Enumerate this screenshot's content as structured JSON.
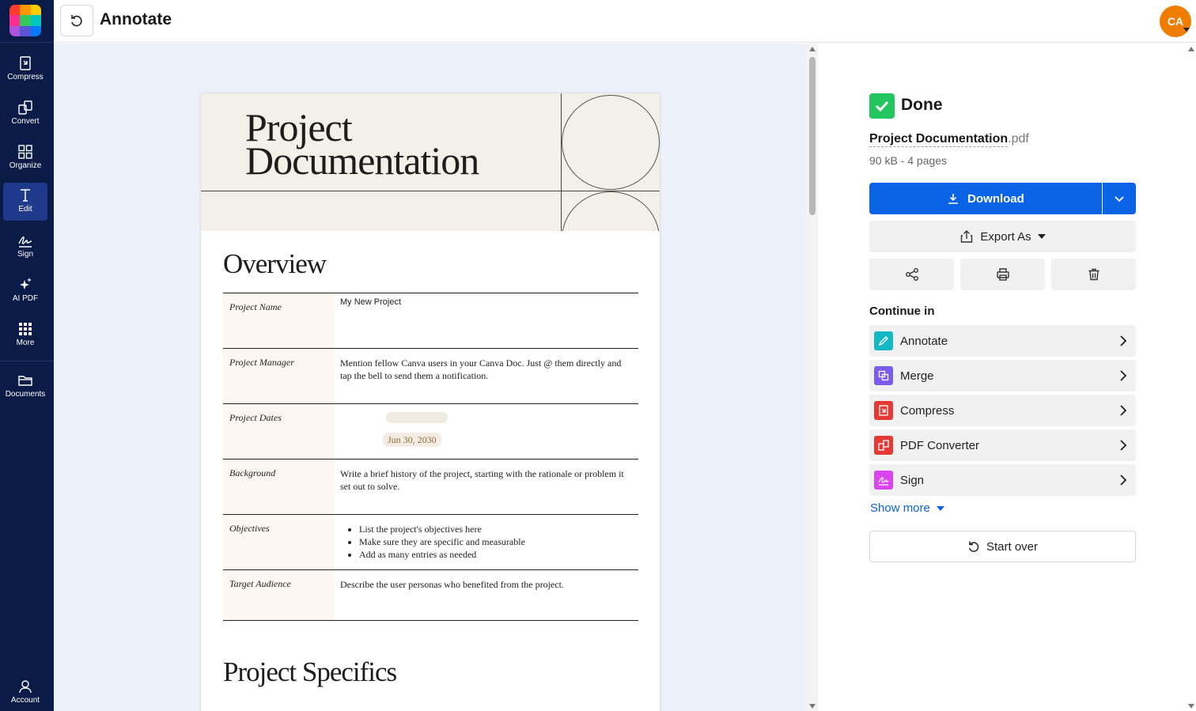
{
  "app": {
    "title": "Annotate",
    "user_initials": "CA"
  },
  "sidebar": {
    "items": [
      {
        "label": "Compress",
        "icon": "compress-icon"
      },
      {
        "label": "Convert",
        "icon": "convert-icon"
      },
      {
        "label": "Organize",
        "icon": "organize-icon"
      },
      {
        "label": "Edit",
        "icon": "edit-icon",
        "active": true
      },
      {
        "label": "Sign",
        "icon": "sign-icon"
      },
      {
        "label": "AI PDF",
        "icon": "ai-sparkle-icon"
      },
      {
        "label": "More",
        "icon": "grid-icon"
      },
      {
        "label": "Documents",
        "icon": "folder-icon"
      }
    ],
    "account_label": "Account"
  },
  "document": {
    "title_line1": "Project",
    "title_line2": "Documentation",
    "overview_heading": "Overview",
    "rows": [
      {
        "label": "Project Name",
        "value": "My New Project"
      },
      {
        "label": "Project Manager",
        "value": "Mention fellow Canva users in your Canva Doc. Just @ them directly and tap the bell to send them a notification."
      },
      {
        "label": "Project Dates",
        "value": "Jun 30, 2030"
      },
      {
        "label": "Background",
        "value": "Write a brief history of the project, starting with the rationale or problem it set out to solve."
      },
      {
        "label": "Objectives",
        "bullets": [
          "List the project's objectives here",
          "Make sure they are specific and measurable",
          "Add as many entries as needed"
        ]
      },
      {
        "label": "Target Audience",
        "value": "Describe the user personas who benefited from the project."
      }
    ],
    "specifics_heading": "Project Specifics"
  },
  "panel": {
    "status": "Done",
    "file_name": "Project Documentation",
    "file_ext": ".pdf",
    "file_meta": "90 kB - 4 pages",
    "download_label": "Download",
    "export_label": "Export As",
    "continue_label": "Continue in",
    "tools": [
      {
        "label": "Annotate",
        "color": "#14b8c4"
      },
      {
        "label": "Merge",
        "color": "#7c5cf0"
      },
      {
        "label": "Compress",
        "color": "#e53935"
      },
      {
        "label": "PDF Converter",
        "color": "#e53935"
      },
      {
        "label": "Sign",
        "color": "#d946ef"
      }
    ],
    "show_more_label": "Show more",
    "start_over_label": "Start over"
  },
  "colors": {
    "sidebar_bg": "#0b1b47",
    "accent_blue": "#0b63e5",
    "done_green": "#22c55e",
    "avatar_orange": "#ef7d00"
  }
}
